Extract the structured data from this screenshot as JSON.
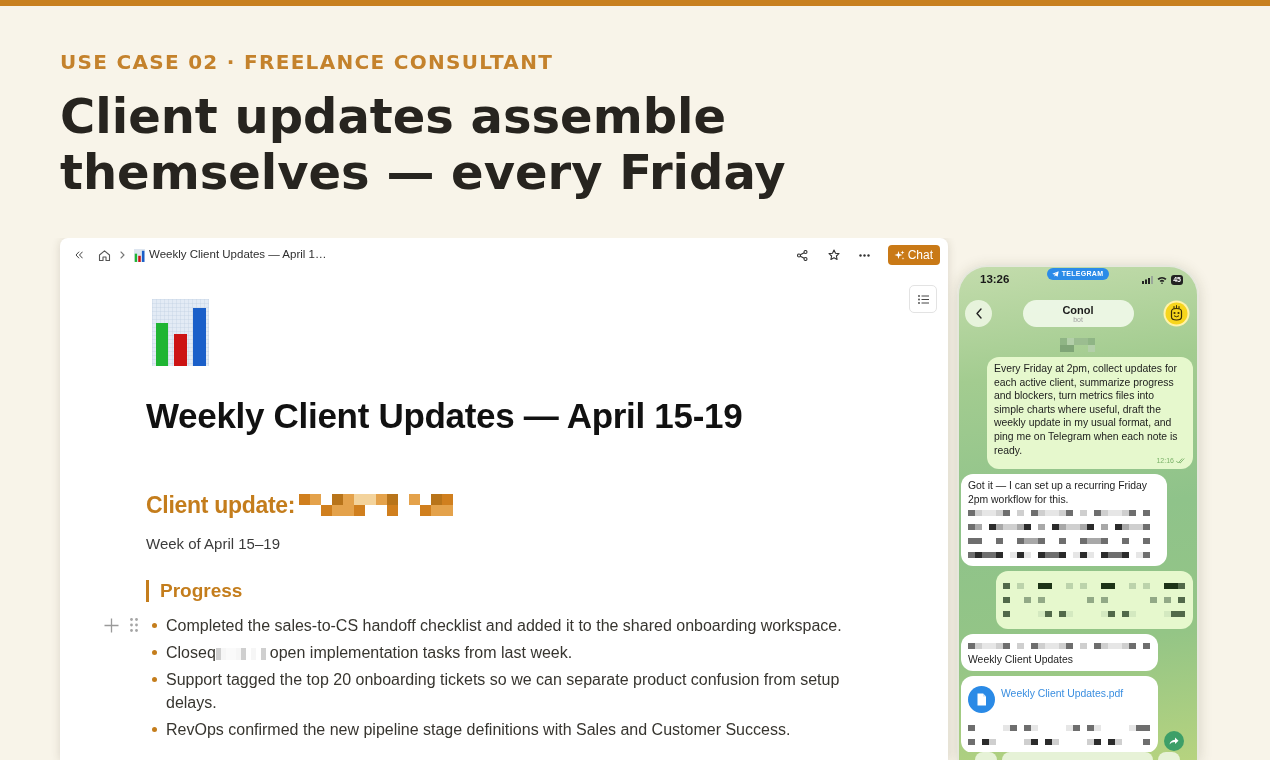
{
  "hero": {
    "eyebrow": "USE CASE 02 · FREELANCE CONSULTANT",
    "headline": "Client updates assemble themselves — every Friday"
  },
  "doc_window": {
    "breadcrumb": {
      "title": "Weekly Client Updates — April 1…"
    },
    "chat_button": "Chat",
    "page": {
      "title": "Weekly Client Updates — April 15-19",
      "heading": {
        "text": "Client update:",
        "redacted": true
      },
      "subtitle": "Week of April 15–19",
      "section": {
        "title": "Progress",
        "items": [
          {
            "hovered": true,
            "parts": [
              {
                "kind": "text",
                "text": "Completed the sales-to-CS handoff checklist and added it to the shared onboarding workspace."
              }
            ]
          },
          {
            "hovered": false,
            "parts": [
              {
                "kind": "text",
                "text": "Closeq"
              },
              {
                "kind": "redacted"
              },
              {
                "kind": "text",
                "text": "open implementation tasks from last week."
              }
            ]
          },
          {
            "hovered": false,
            "parts": [
              {
                "kind": "text",
                "text": "Support tagged the top 20 onboarding tickets so we can separate product confusion from setup delays."
              }
            ]
          },
          {
            "hovered": false,
            "parts": [
              {
                "kind": "text",
                "text": "RevOps confirmed the new pipeline stage definitions with Sales and Customer Success."
              }
            ]
          }
        ]
      }
    }
  },
  "phone": {
    "status_bar": {
      "time": "13:26",
      "app": "TELEGRAM",
      "battery": "45"
    },
    "chat": {
      "name": "Conol",
      "subtitle": "bot"
    },
    "messages": [
      {
        "kind": "redacted"
      },
      {
        "kind": "outgoing",
        "parts": [
          {
            "kind": "text",
            "text": "Every Friday at 2pm, collect updates for each active client, summarize progress and blockers, turn metrics files into simple charts where useful, draft the weekly update in my usual format, and ping me on Telegram when each note is ready."
          }
        ],
        "time": "12:16",
        "read": true
      },
      {
        "kind": "incoming",
        "parts": [
          {
            "kind": "text",
            "text": "Got it — I can set up a recurring Friday 2pm workflow for this."
          },
          {
            "kind": "redacted"
          },
          {
            "kind": "redacted"
          },
          {
            "kind": "redacted"
          },
          {
            "kind": "redacted"
          }
        ]
      },
      {
        "kind": "outgoing",
        "parts": [
          {
            "kind": "redacted"
          },
          {
            "kind": "redacted"
          },
          {
            "kind": "redacted"
          }
        ]
      },
      {
        "kind": "incoming",
        "parts": [
          {
            "kind": "redacted"
          },
          {
            "kind": "text",
            "text": "Weekly Client Updates"
          }
        ]
      },
      {
        "kind": "incoming",
        "parts": [
          {
            "kind": "file",
            "text": "Weekly Client Updates.pdf"
          },
          {
            "kind": "redacted"
          },
          {
            "kind": "redacted"
          }
        ],
        "forward": true
      }
    ]
  }
}
